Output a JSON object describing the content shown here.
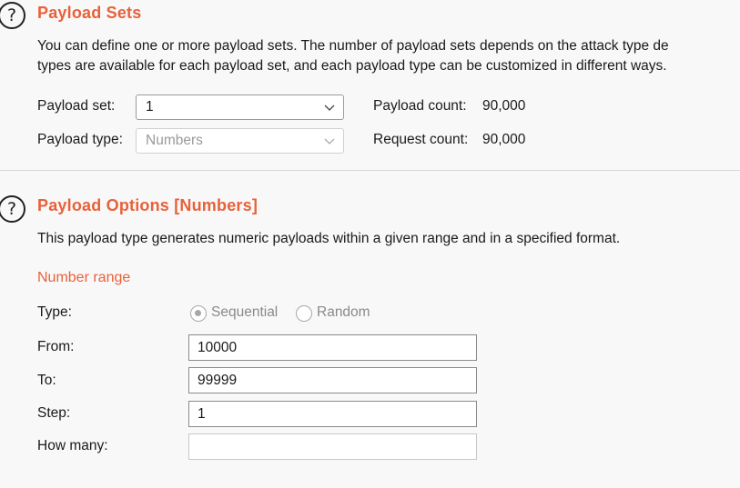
{
  "payload_sets": {
    "title": "Payload Sets",
    "description_line1": "You can define one or more payload sets. The number of payload sets depends on the attack type de",
    "description_line2": "types are available for each payload set, and each payload type can be customized in different ways.",
    "set_label": "Payload set:",
    "set_value": "1",
    "type_label": "Payload type:",
    "type_value": "Numbers",
    "payload_count_label": "Payload count:",
    "payload_count_value": "90,000",
    "request_count_label": "Request count:",
    "request_count_value": "90,000"
  },
  "payload_options": {
    "title": "Payload Options [Numbers]",
    "description": "This payload type generates numeric payloads within a given range and in a specified format.",
    "number_range_heading": "Number range",
    "type_label": "Type:",
    "radio_sequential": "Sequential",
    "radio_random": "Random",
    "selected_type": "Sequential",
    "from_label": "From:",
    "from_value": "10000",
    "to_label": "To:",
    "to_value": "99999",
    "step_label": "Step:",
    "step_value": "1",
    "how_many_label": "How many:",
    "how_many_value": ""
  },
  "icons": {
    "help": "question-circle-icon",
    "dropdown": "chevron-down-icon"
  },
  "colors": {
    "accent": "#e8613a",
    "background": "#f8f8f8"
  }
}
